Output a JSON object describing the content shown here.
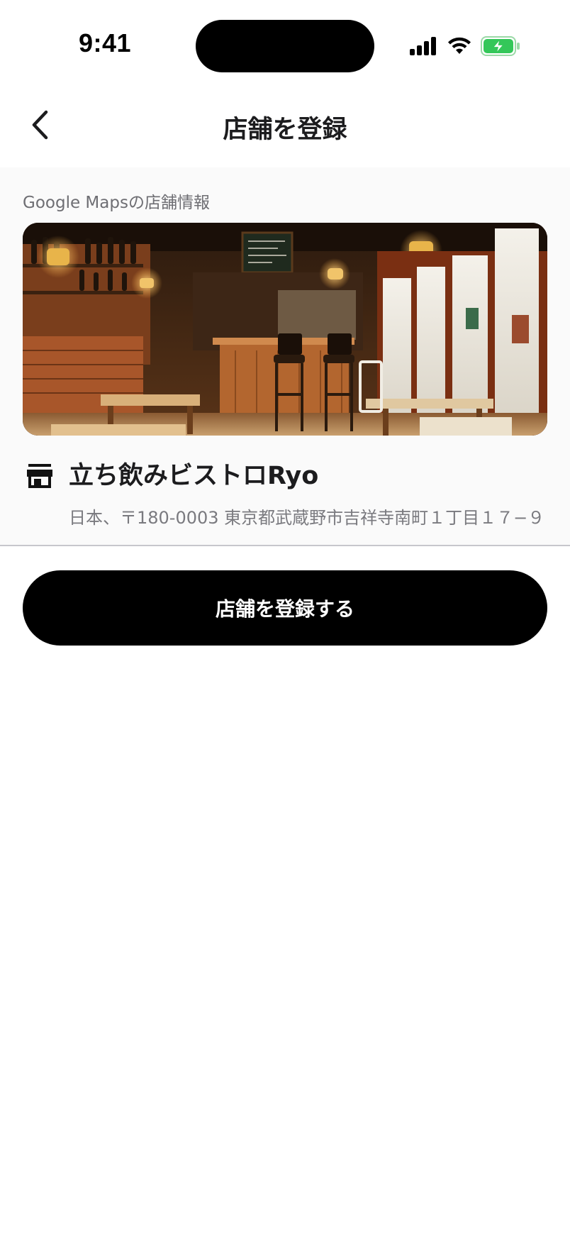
{
  "status_bar": {
    "time": "9:41",
    "icons": [
      "signal-icon",
      "wifi-icon",
      "battery-charging-icon"
    ],
    "battery_color": "#34c759"
  },
  "nav": {
    "back_icon": "chevron-left-icon",
    "title": "店舗を登録"
  },
  "maps_section": {
    "label": "Google Mapsの店舗情報",
    "photo_description_icon": "store-photo",
    "store": {
      "icon": "storefront-icon",
      "name": "立ち飲みビストロRyo",
      "address": "日本、〒180-0003 東京都武蔵野市吉祥寺南町１丁目１７−９"
    }
  },
  "actions": {
    "register_label": "店舗を登録する"
  },
  "colors": {
    "primary_button": "#000000",
    "section_background": "#fafafa",
    "secondary_text": "#7a7a7f"
  }
}
